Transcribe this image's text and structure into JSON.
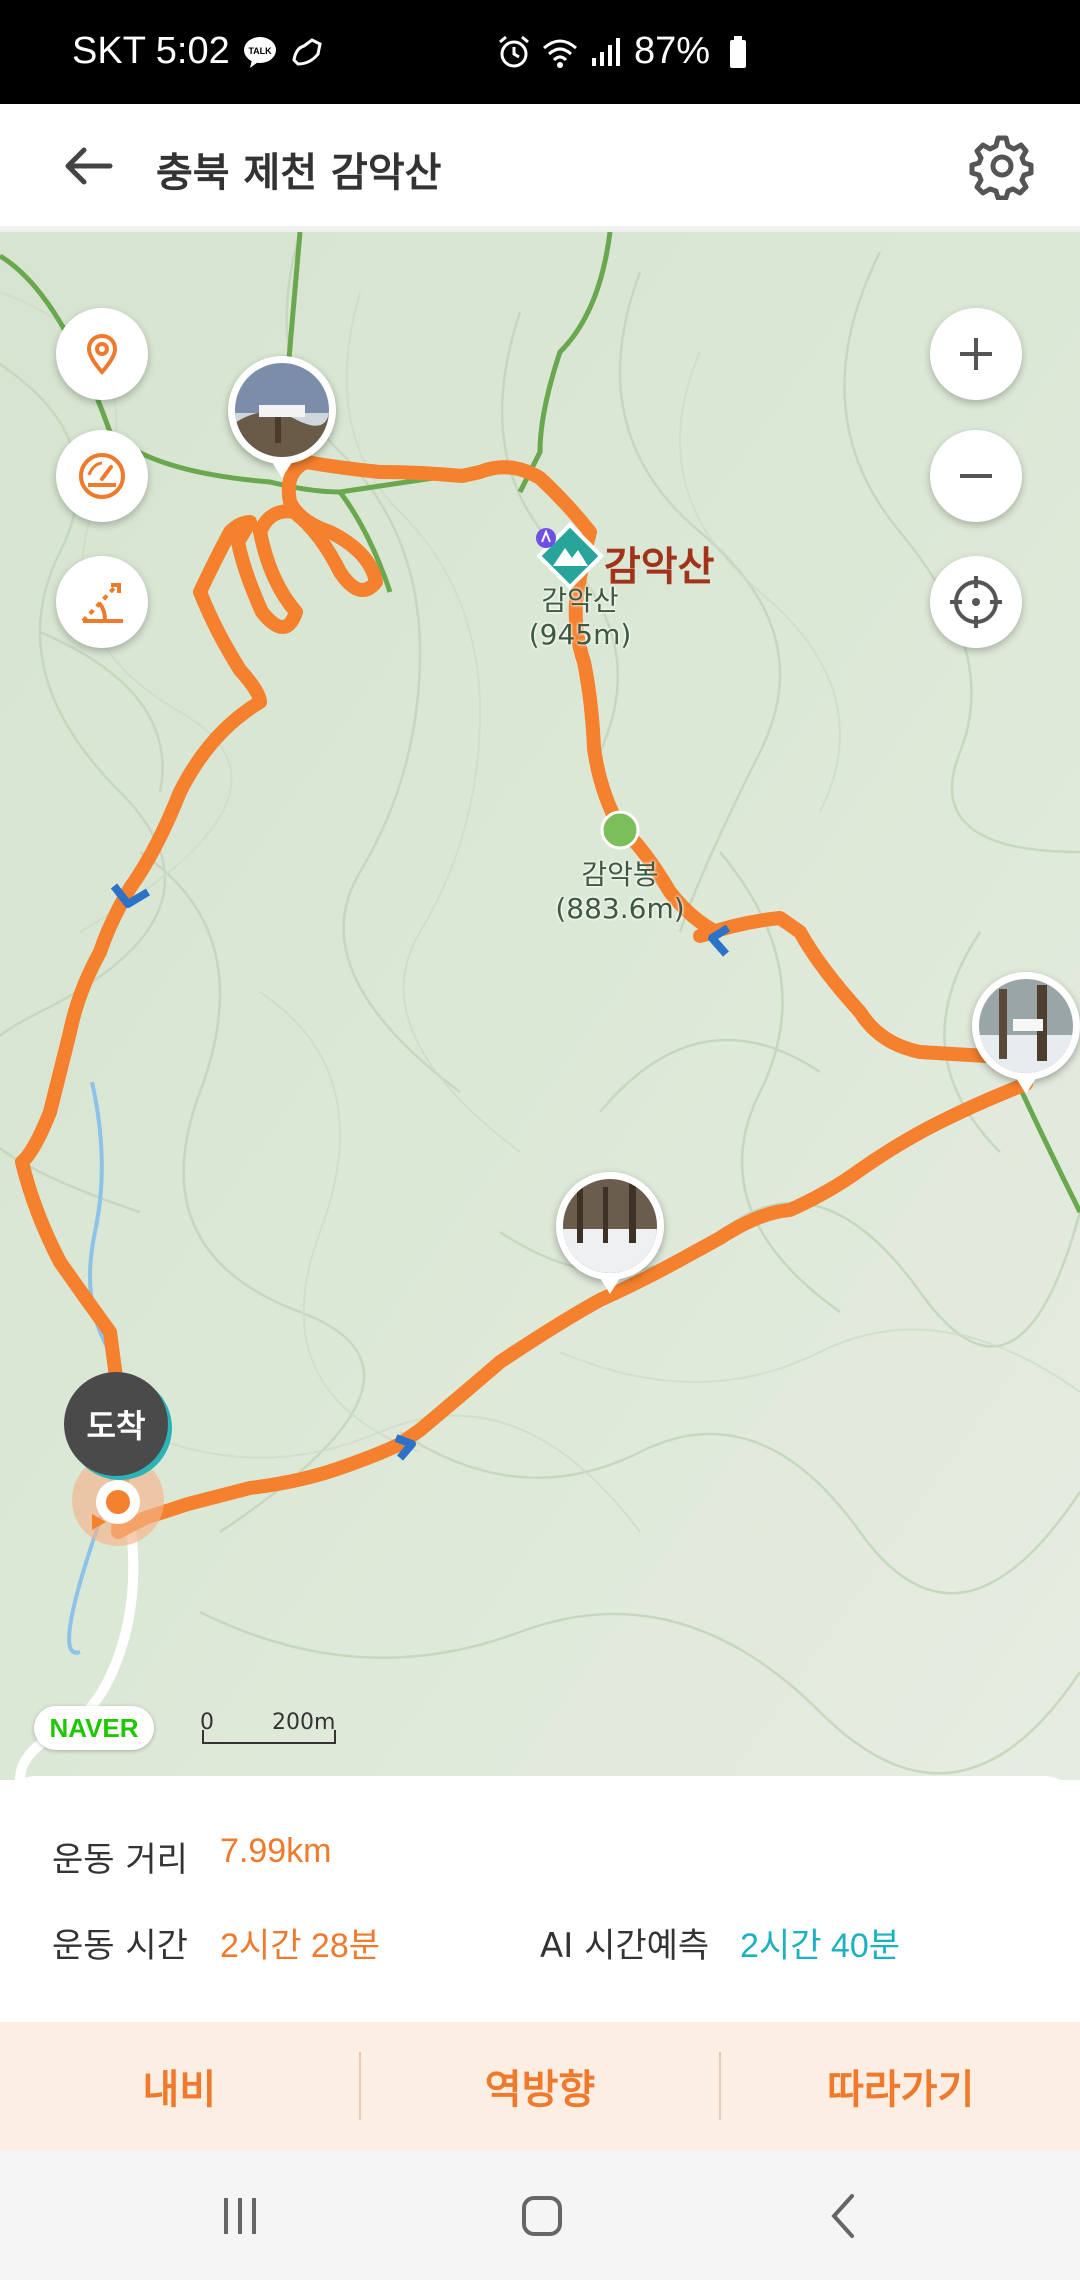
{
  "status_bar": {
    "carrier_time": "SKT 5:02",
    "battery": "87%",
    "icons": [
      "kakaotalk-icon",
      "shoe-icon",
      "alarm-icon",
      "wifi-icon",
      "signal-icon",
      "battery-icon"
    ]
  },
  "header": {
    "title": "충북 제천 감악산",
    "back_icon": "back-arrow-icon",
    "settings_icon": "gear-icon"
  },
  "map": {
    "peak_name": "감악산",
    "peak_label": "감악산",
    "peak_elevation": "(945m)",
    "ridge_label": "감악봉",
    "ridge_elevation": "(883.6m)",
    "arrival_label": "도착",
    "provider": "NAVER",
    "scale_zero": "0",
    "scale_distance": "200m",
    "route_color": "#f5802d",
    "controls": {
      "left": [
        "location-pin-icon",
        "speedometer-icon",
        "ruler-slope-icon"
      ],
      "right": [
        "zoom-in-icon",
        "zoom-out-icon",
        "my-location-icon"
      ]
    }
  },
  "stats": {
    "distance_label": "운동 거리",
    "distance_value": "7.99km",
    "time_label": "운동 시간",
    "time_value": "2시간 28분",
    "ai_label": "AI 시간예측",
    "ai_value": "2시간 40분",
    "accent_color": "#f07a2b",
    "ai_color": "#1bb1c0"
  },
  "actions": {
    "navi": "내비",
    "reverse": "역방향",
    "follow": "따라가기"
  },
  "nav_bar": [
    "recent-apps-icon",
    "home-icon",
    "back-icon"
  ]
}
